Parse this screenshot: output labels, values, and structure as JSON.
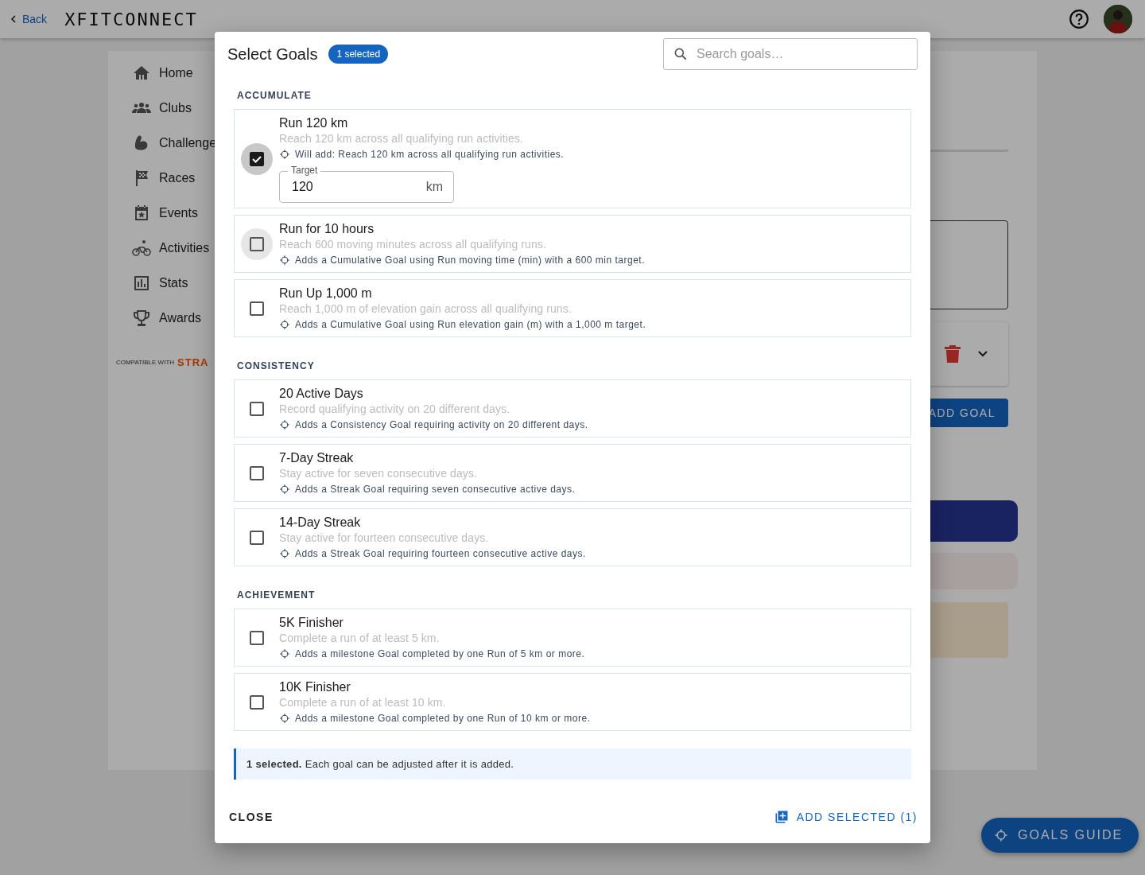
{
  "header": {
    "back": "Back",
    "logo": "XFITCONNECT"
  },
  "sidebar": {
    "items": [
      {
        "label": "Home"
      },
      {
        "label": "Clubs"
      },
      {
        "label": "Challenge"
      },
      {
        "label": "Races"
      },
      {
        "label": "Events"
      },
      {
        "label": "Activities"
      },
      {
        "label": "Stats"
      },
      {
        "label": "Awards"
      }
    ],
    "compatible": "COMPATIBLE WITH",
    "brand": "STRA"
  },
  "content": {
    "add_goal": "ADD GOAL"
  },
  "fab": {
    "label": "GOALS GUIDE"
  },
  "dialog": {
    "title": "Select Goals",
    "badge": "1 selected",
    "search": {
      "placeholder": "Search goals…"
    },
    "sections": [
      {
        "heading": "ACCUMULATE",
        "goals": [
          {
            "title": "Run 120 km",
            "description": "Reach 120 km across all qualifying run activities.",
            "note": "Will add: Reach 120 km across all qualifying run activities.",
            "checked": true,
            "focused": true,
            "target": {
              "label": "Target",
              "value": "120",
              "unit": "km"
            }
          },
          {
            "title": "Run for 10 hours",
            "description": "Reach 600 moving minutes across all qualifying runs.",
            "note": "Adds a Cumulative Goal using Run moving time (min) with a 600 min target.",
            "checked": false,
            "focused": true
          },
          {
            "title": "Run Up 1,000 m",
            "description": "Reach 1,000 m of elevation gain across all qualifying runs.",
            "note": "Adds a Cumulative Goal using Run elevation gain (m) with a 1,000 m target.",
            "checked": false,
            "focused": false
          }
        ]
      },
      {
        "heading": "CONSISTENCY",
        "goals": [
          {
            "title": "20 Active Days",
            "description": "Record qualifying activity on 20 different days.",
            "note": "Adds a Consistency Goal requiring activity on 20 different days.",
            "checked": false,
            "focused": false
          },
          {
            "title": "7-Day Streak",
            "description": "Stay active for seven consecutive days.",
            "note": "Adds a Streak Goal requiring seven consecutive active days.",
            "checked": false,
            "focused": false
          },
          {
            "title": "14-Day Streak",
            "description": "Stay active for fourteen consecutive days.",
            "note": "Adds a Streak Goal requiring fourteen consecutive active days.",
            "checked": false,
            "focused": false
          }
        ]
      },
      {
        "heading": "ACHIEVEMENT",
        "goals": [
          {
            "title": "5K Finisher",
            "description": "Complete a run of at least 5 km.",
            "note": "Adds a milestone Goal completed by one Run of 5 km or more.",
            "checked": false,
            "focused": false
          },
          {
            "title": "10K Finisher",
            "description": "Complete a run of at least 10 km.",
            "note": "Adds a milestone Goal completed by one Run of 10 km or more.",
            "checked": false,
            "focused": false
          }
        ]
      }
    ],
    "summary": "**1 selected.** Each goal can be adjusted after it is added.",
    "actions": {
      "close": "CLOSE",
      "add": "ADD SELECTED (1)"
    }
  }
}
